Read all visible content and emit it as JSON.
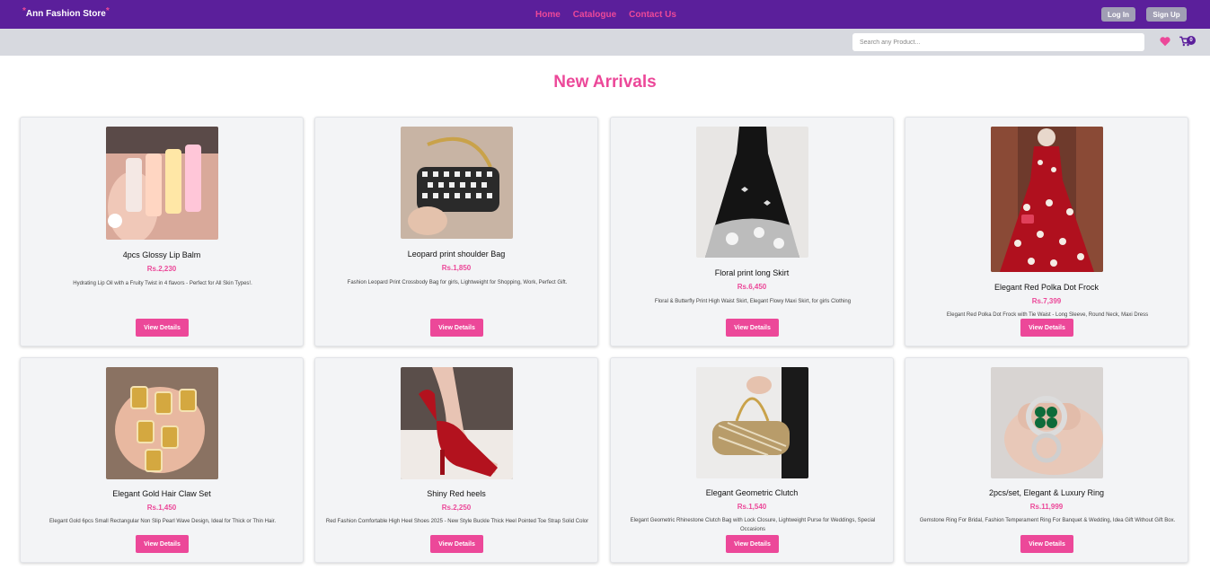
{
  "header": {
    "brand": "Ann Fashion Store",
    "nav": [
      "Home",
      "Catalogue",
      "Contact Us"
    ],
    "login_label": "Log In",
    "signup_label": "Sign Up"
  },
  "toolbar": {
    "search_placeholder": "Search any Product...",
    "cart_count": "0"
  },
  "colors": {
    "primary": "#5b1f9b",
    "accent": "#ec4899"
  },
  "section_title": "New Arrivals",
  "button_label": "View Details",
  "products": [
    {
      "name": "4pcs Glossy Lip Balm",
      "price": "Rs.2,230",
      "desc": "Hydrating Lip Oil with a Fruity Twist in 4 flavors - Perfect for All Skin Types!.",
      "image": "lip-balm-image"
    },
    {
      "name": "Leopard print shoulder Bag",
      "price": "Rs.1,850",
      "desc": "Fashion Leopard Print Crossbody Bag for girls, Lightweight for Shopping, Work, Perfect Gift.",
      "image": "shoulder-bag-image"
    },
    {
      "name": "Floral print long Skirt",
      "price": "Rs.6,450",
      "desc": "Floral & Butterfly Print High Waist Skirt, Elegant Flowy Maxi Skirt, for girls Clothing",
      "image": "skirt-image"
    },
    {
      "name": "Elegant Red Polka Dot Frock",
      "price": "Rs.7,399",
      "desc": "Elegant Red Polka Dot Frock with Tie Waist - Long Sleeve, Round Neck, Maxi Dress",
      "image": "frock-image"
    },
    {
      "name": "Elegant Gold Hair Claw Set",
      "price": "Rs.1,450",
      "desc": "Elegant Gold 6pcs Small Rectangular Non Slip Pearl Wave Design, Ideal for Thick or Thin Hair.",
      "image": "hair-claw-image"
    },
    {
      "name": "Shiny Red heels",
      "price": "Rs.2,250",
      "desc": "Red Fashion Comfortable High Heel Shoes 2025 - New Style Buckle Thick Heel Pointed Toe Strap Solid Color",
      "image": "heels-image"
    },
    {
      "name": "Elegant Geometric Clutch",
      "price": "Rs.1,540",
      "desc": "Elegant Geometric Rhinestone Clutch Bag with Lock Closure, Lightweight Purse for Weddings, Special Occasions",
      "image": "clutch-image"
    },
    {
      "name": "2pcs/set, Elegant & Luxury Ring",
      "price": "Rs.11,999",
      "desc": "Gemstone Ring For Bridal, Fashion Temperament Ring For Banquet & Wedding, Idea Gift Without Gift Box.",
      "image": "ring-image"
    }
  ]
}
